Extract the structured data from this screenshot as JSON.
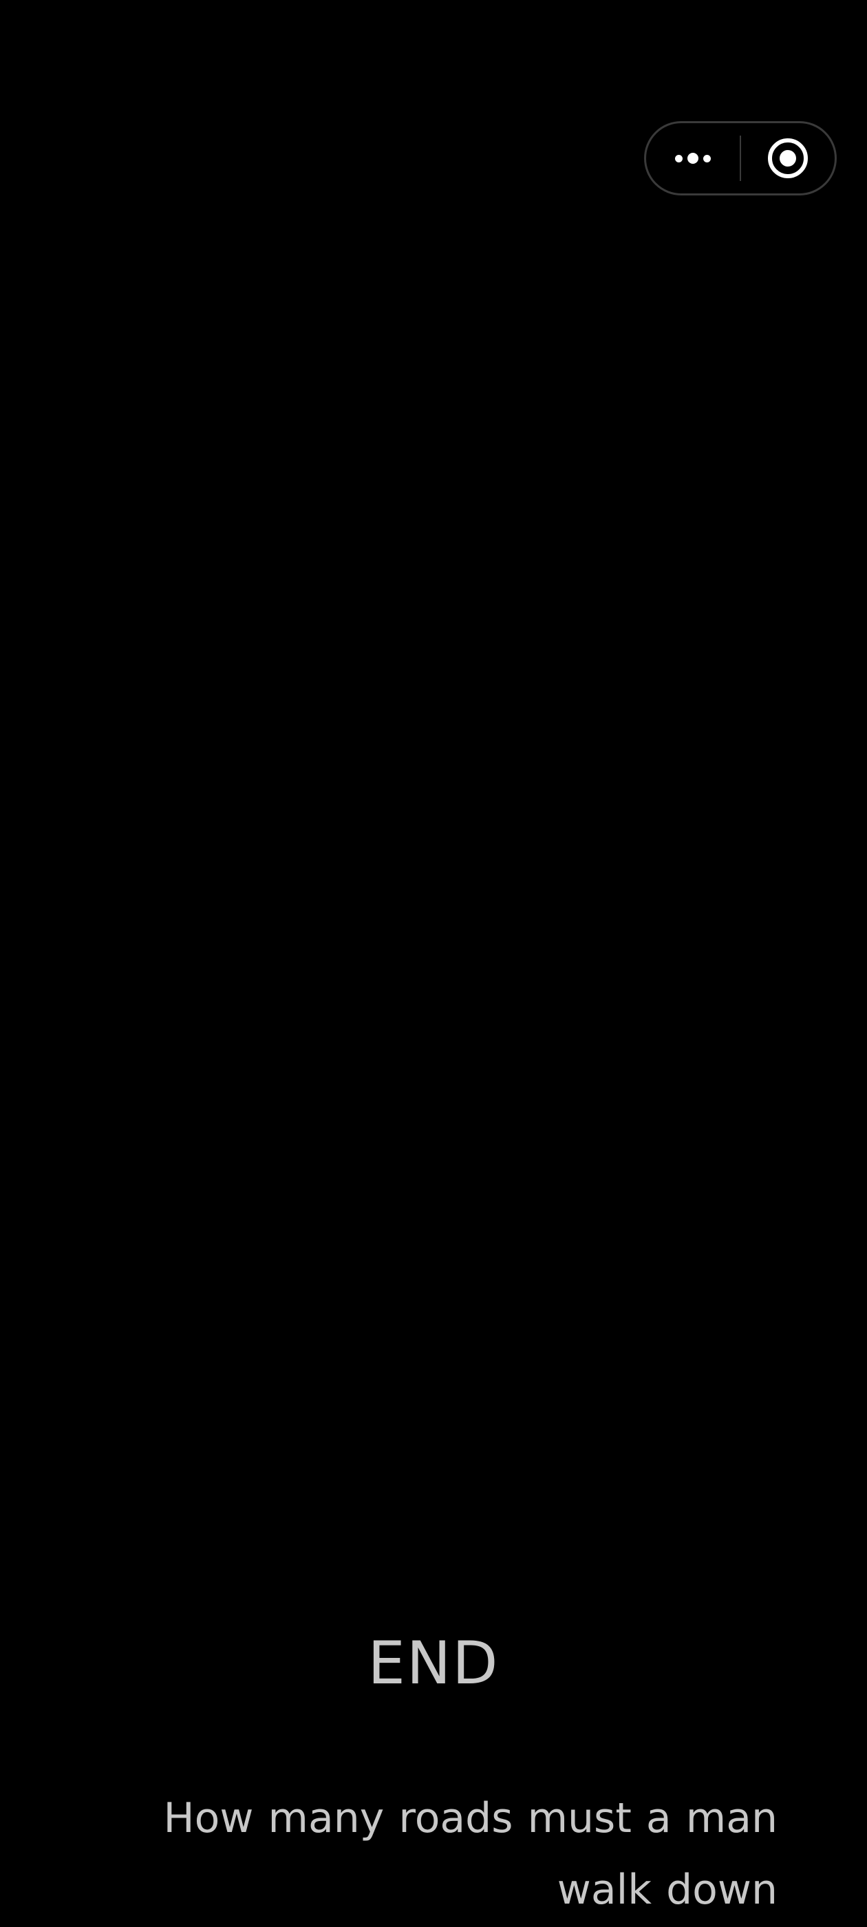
{
  "capsule": {
    "more_icon": "more-dots-icon",
    "close_icon": "target-circle-icon"
  },
  "content": {
    "title": "END",
    "lyric": "How many roads must a man walk down"
  },
  "colors": {
    "background": "#000000",
    "text": "#c8c8c8",
    "capsule_border": "#3a3a3a",
    "icon": "#ffffff"
  }
}
